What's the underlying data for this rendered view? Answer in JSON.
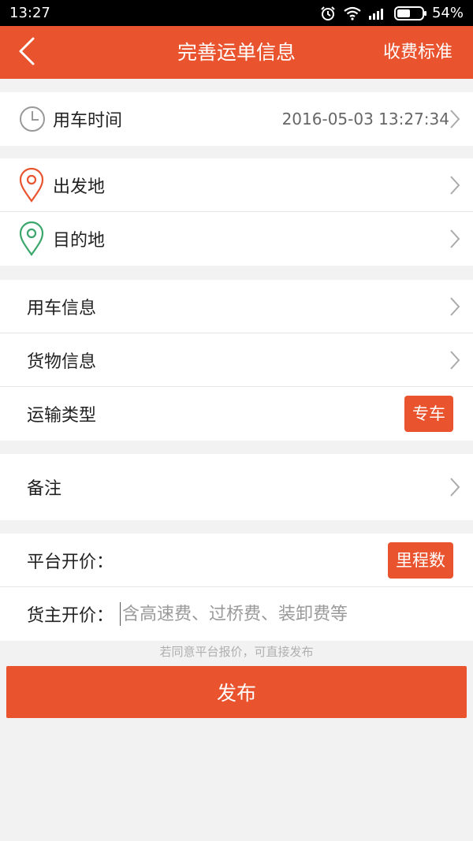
{
  "status_bar": {
    "time": "13:27",
    "battery": "54%",
    "battery_level": 0.54
  },
  "header": {
    "title": "完善运单信息",
    "action": "收费标准",
    "back_icon": "chevron-left-icon"
  },
  "time_section": {
    "label": "用车时间",
    "value": "2016-05-03 13:27:34",
    "icon": "clock-icon"
  },
  "location_section": {
    "origin_label": "出发地",
    "destination_label": "目的地",
    "origin_color": "#e9532e",
    "destination_color": "#3aa66a"
  },
  "info_section": {
    "vehicle_info_label": "用车信息",
    "cargo_info_label": "货物信息",
    "transport_type_label": "运输类型",
    "transport_type_value": "专车"
  },
  "remark_section": {
    "remark_label": "备注"
  },
  "price_section": {
    "platform_price_label": "平台开价：",
    "mileage_button": "里程数",
    "owner_price_label": "货主开价：",
    "owner_price_placeholder": "含高速费、过桥费、装卸费等",
    "owner_price_value": ""
  },
  "hint": "若同意平台报价，可直接发布",
  "publish_button": "发布",
  "colors": {
    "accent": "#e9532e",
    "background": "#f2f2f2"
  }
}
